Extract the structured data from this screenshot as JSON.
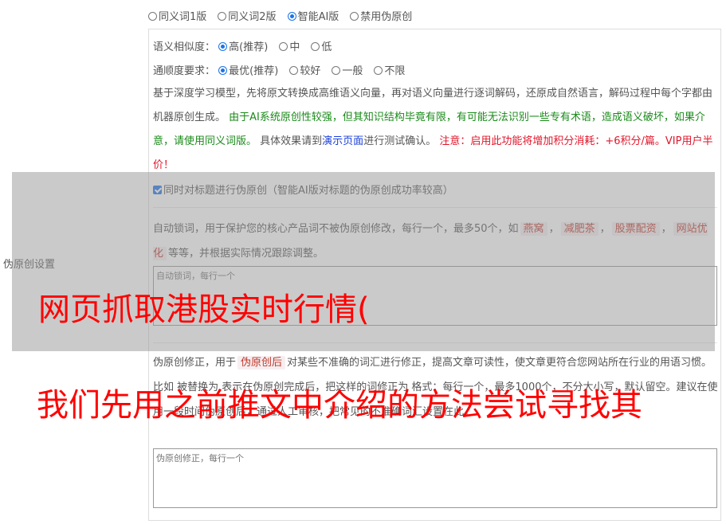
{
  "version_options": [
    {
      "label": "同义词1版",
      "selected": false
    },
    {
      "label": "同义词2版",
      "selected": false
    },
    {
      "label": "智能AI版",
      "selected": true
    },
    {
      "label": "禁用伪原创",
      "selected": false
    }
  ],
  "similarity": {
    "label": "语义相似度：",
    "options": [
      {
        "label": "高(推荐)",
        "selected": true
      },
      {
        "label": "中",
        "selected": false
      },
      {
        "label": "低",
        "selected": false
      }
    ]
  },
  "fluency": {
    "label": "通顺度要求：",
    "options": [
      {
        "label": "最优(推荐)",
        "selected": true
      },
      {
        "label": "较好",
        "selected": false
      },
      {
        "label": "一般",
        "selected": false
      },
      {
        "label": "不限",
        "selected": false
      }
    ]
  },
  "description": {
    "part1": "基于深度学习模型，先将原文转换成高维语义向量，再对语义向量进行逐词解码，还原成自然语言，解码过程中每个字都由机器原创生成。",
    "part2": "由于AI系统原创性较强，但其知识结构毕竟有限，有可能无法识别一些专有术语，造成语义破坏，如果介意，请使用同义词版。",
    "part3": "具体效果请到",
    "link": "演示页面",
    "part4": "进行测试确认。",
    "warning": "注意：启用此功能将增加积分消耗：+6积分/篇。VIP用户半价！"
  },
  "title_checkbox": {
    "checked": true,
    "label": "同时对标题进行伪原创（智能AI版对标题的伪原创成功率较高）"
  },
  "lock": {
    "desc_before": "自动锁词，用于保护您的核心产品词不被伪原创修改，每行一个，最多50个，如",
    "tags": [
      "燕窝",
      "减肥茶",
      "股票配资",
      "网站优化"
    ],
    "desc_after": "等等，并根据实际情况跟踪调整。",
    "placeholder": "自动锁词，每行一个"
  },
  "side_label": "伪原创设置",
  "fix": {
    "desc_before": "伪原创修正，用于",
    "tag": "伪原创后",
    "desc_after": "对某些不准确的词汇进行修正，提高文章可读性，使文章更符合您网站所在行业的用语习惯。比如 被替换为 表示在伪原创完成后，把这样的词修正为 格式：每行一个，最多1000个，不分大小写，默认留空。建议在使用一段时间伪原创后，通过人工审核，把常见的不准确词汇设置在此。",
    "placeholder": "伪原创修正，每行一个"
  },
  "watermark": {
    "line1": "网页抓取港股实时行情(",
    "line2": "我们先用之前推文中介绍的方法尝试寻找其"
  }
}
